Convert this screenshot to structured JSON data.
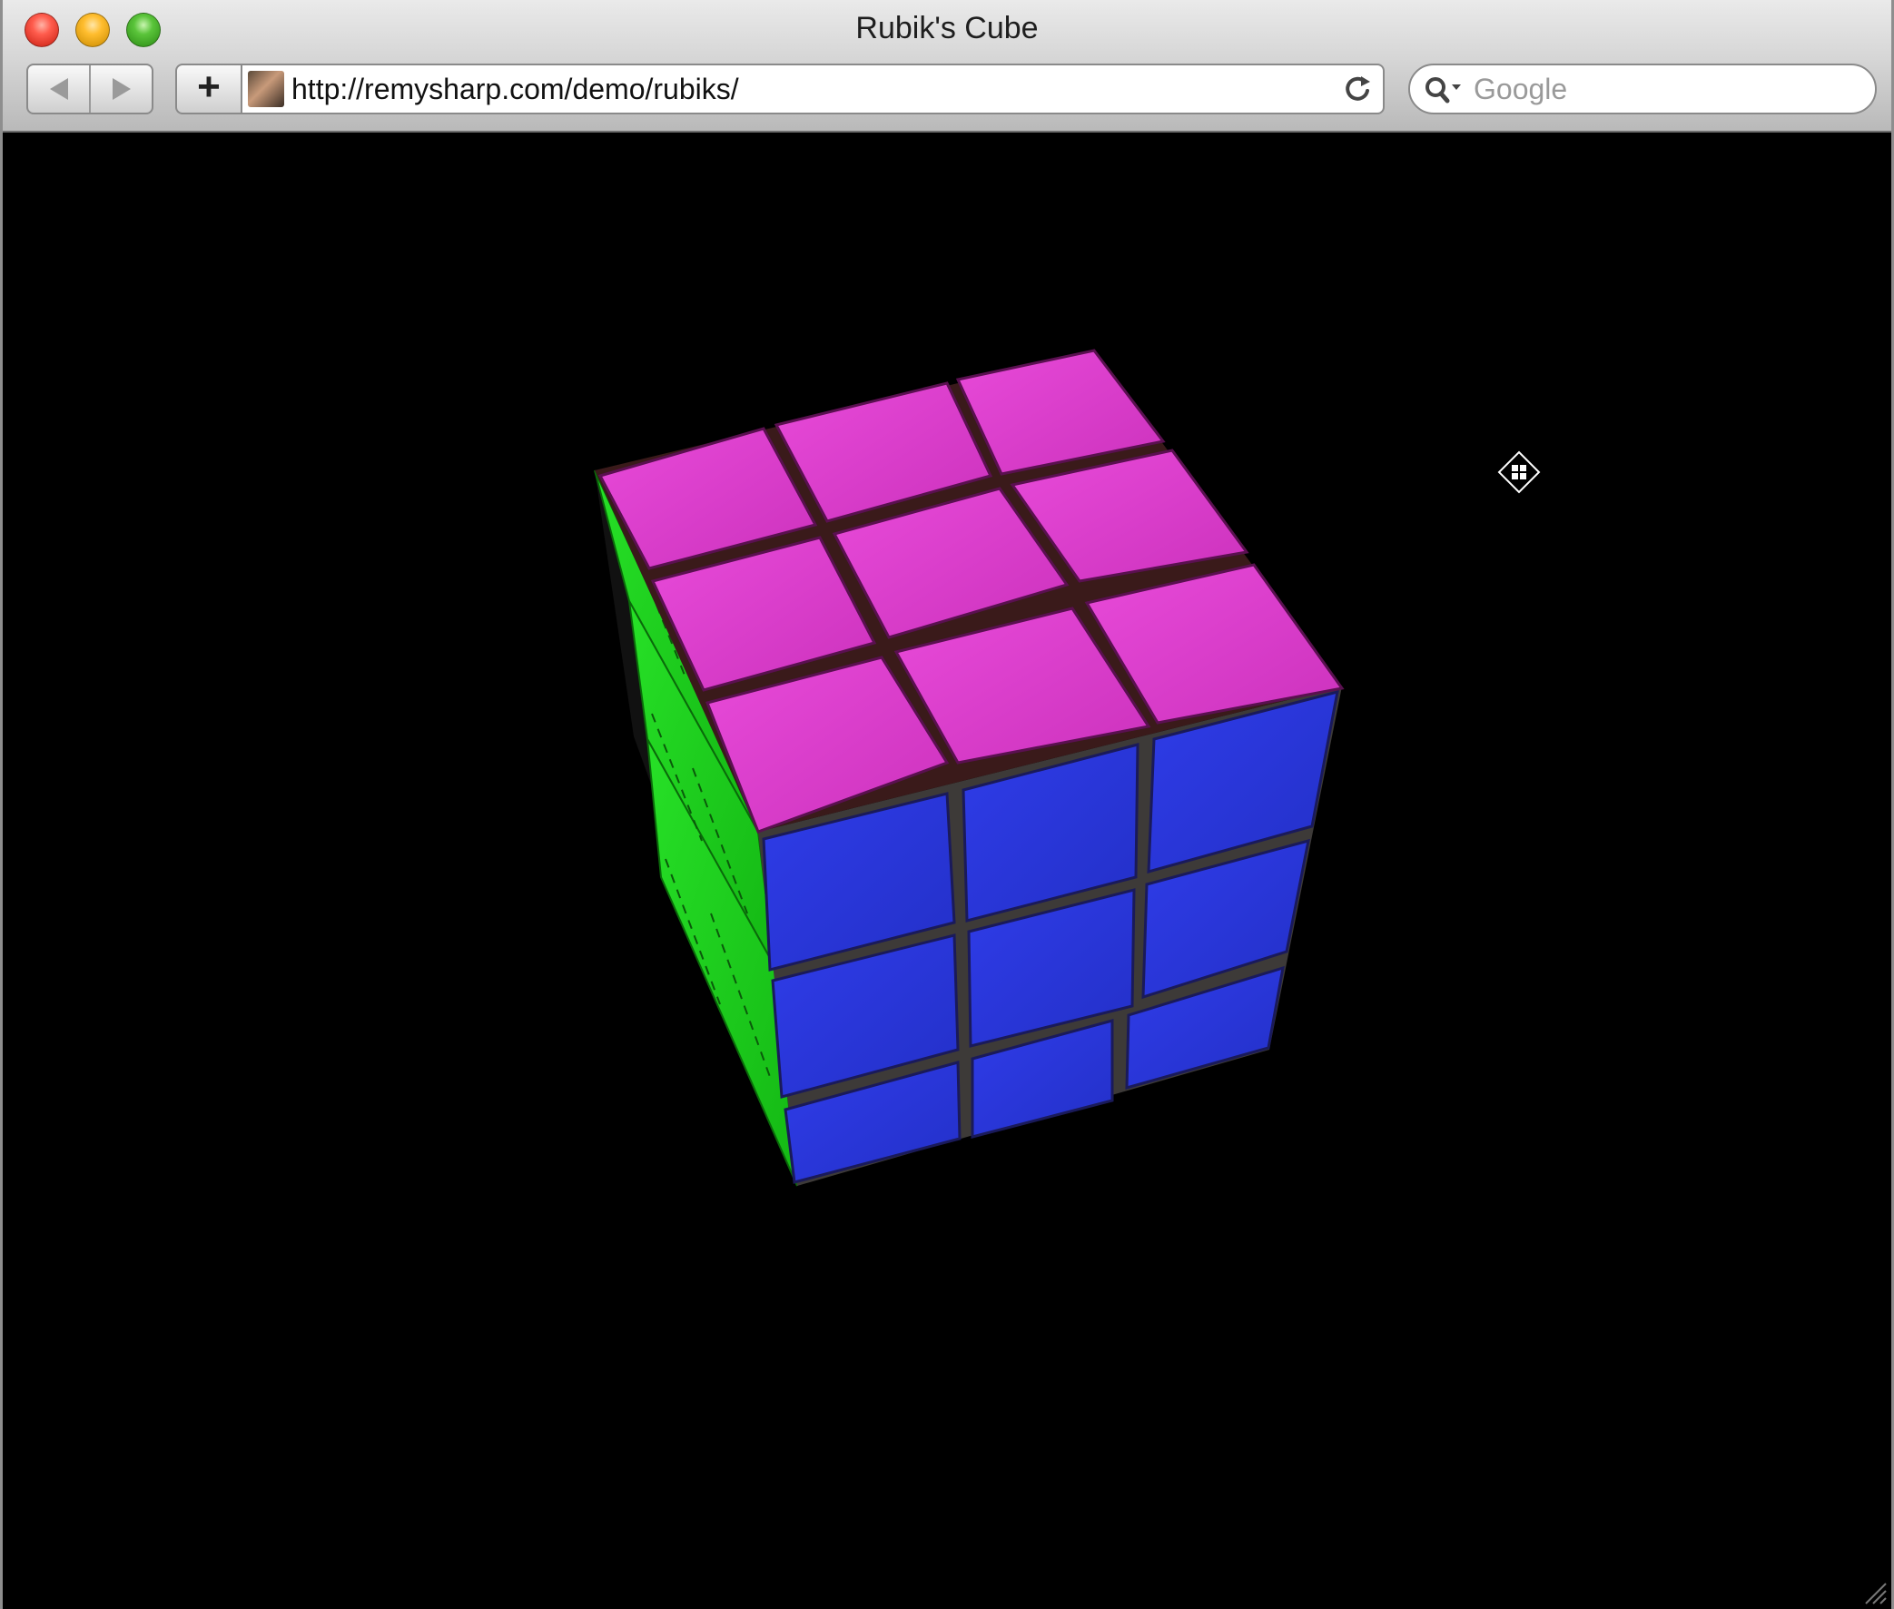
{
  "window": {
    "title": "Rubik's Cube"
  },
  "toolbar": {
    "back_icon": "back-arrow-icon",
    "forward_icon": "forward-arrow-icon",
    "add_label": "+",
    "url": "http://remysharp.com/demo/rubiks/",
    "reload_icon": "reload-icon",
    "search_placeholder": "Google"
  },
  "content": {
    "background": "#000000",
    "cube": {
      "grid": "3x3x3",
      "faces": {
        "top": {
          "color": "#d63cc8",
          "name": "magenta"
        },
        "front": {
          "color": "#2a37d8",
          "name": "blue"
        },
        "left": {
          "color": "#1fd11f",
          "name": "green"
        }
      }
    },
    "cursor_icon": "move-cursor-icon"
  }
}
